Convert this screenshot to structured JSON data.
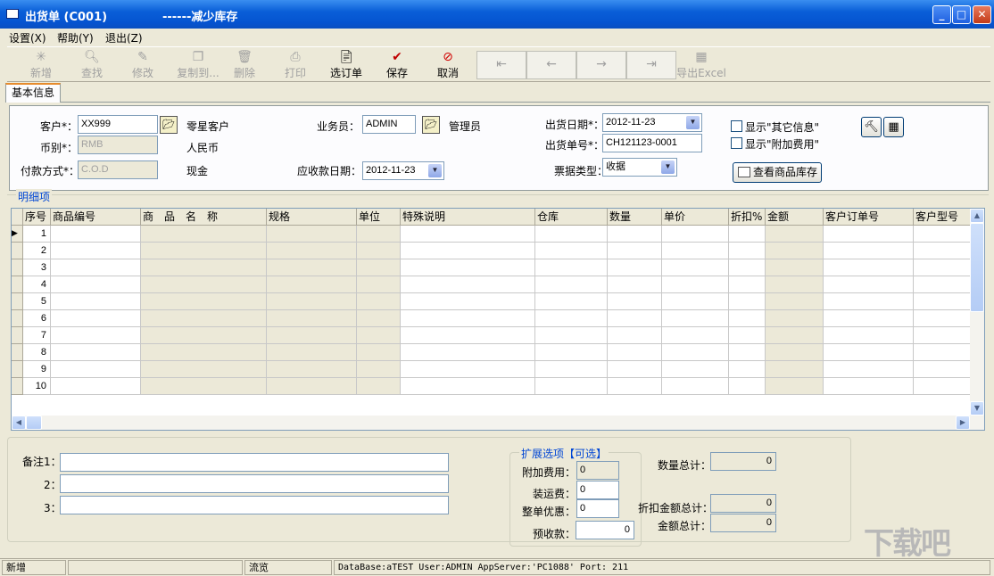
{
  "window": {
    "title": "出货单 (C001)",
    "subtitle": "------减少库存",
    "min_icon": "minimize-icon",
    "max_icon": "maximize-icon",
    "close_icon": "close-icon"
  },
  "menu": [
    "设置(X)",
    "帮助(Y)",
    "退出(Z)"
  ],
  "toolbar": [
    {
      "label": "新增",
      "icon": "new-icon",
      "enabled": false
    },
    {
      "label": "查找",
      "icon": "search-icon",
      "enabled": false
    },
    {
      "label": "修改",
      "icon": "edit-icon",
      "enabled": false
    },
    {
      "label": "复制到...",
      "icon": "copy-icon",
      "enabled": false
    },
    {
      "label": "删除",
      "icon": "delete-icon",
      "enabled": false
    },
    {
      "label": "打印",
      "icon": "print-icon",
      "enabled": false
    },
    {
      "label": "选订单",
      "icon": "select-order-icon",
      "enabled": true
    },
    {
      "label": "保存",
      "icon": "check-icon",
      "enabled": true
    },
    {
      "label": "取消",
      "icon": "cancel-icon",
      "enabled": true
    },
    {
      "label": "",
      "icon": "first-record-icon",
      "enabled": false
    },
    {
      "label": "",
      "icon": "prev-record-icon",
      "enabled": false
    },
    {
      "label": "",
      "icon": "next-record-icon",
      "enabled": false
    },
    {
      "label": "",
      "icon": "last-record-icon",
      "enabled": false
    },
    {
      "label": "导出Excel",
      "icon": "excel-icon",
      "enabled": false
    }
  ],
  "tab": "基本信息",
  "form": {
    "customer_label": "客户*：",
    "customer_value": "XX999",
    "customer_name": "零星客户",
    "currency_label": "币别*：",
    "currency_value": "RMB",
    "currency_name": "人民币",
    "payment_label": "付款方式*：",
    "payment_value": "C.O.D",
    "payment_name": "现金",
    "salesman_label": "业务员：",
    "salesman_value": "ADMIN",
    "salesman_name": "管理员",
    "receivable_date_label": "应收款日期：",
    "receivable_date_value": "2012-11-23",
    "ship_date_label": "出货日期*：",
    "ship_date_value": "2012-11-23",
    "ship_no_label": "出货单号*：",
    "ship_no_value": "CH121123-0001",
    "invoice_type_label": "票据类型：",
    "invoice_type_value": "收据",
    "show_other_label": "显示\"其它信息\"",
    "show_other_checked": false,
    "show_extra_label": "显示\"附加费用\"",
    "show_extra_checked": false,
    "stock_button": "查看商品库存"
  },
  "grid": {
    "group_label": "明细项",
    "columns": [
      "序号",
      "商品编号",
      "商　品　名　称",
      "规格",
      "单位",
      "特殊说明",
      "仓库",
      "数量",
      "单价",
      "折扣%",
      "金额",
      "客户订单号",
      "客户型号"
    ],
    "rows": [
      "1",
      "2",
      "3",
      "4",
      "5",
      "6",
      "7",
      "8",
      "9",
      "10"
    ]
  },
  "bottom": {
    "remark1_label": "备注1：",
    "remark2_label": "2：",
    "remark3_label": "3：",
    "ext_label": "扩展选项【可选】",
    "extra_fee_label": "附加费用：",
    "extra_fee_value": "0",
    "freight_label": "装运费：",
    "freight_value": "0",
    "discount_label": "整单优惠：",
    "discount_value": "0",
    "prepaid_label": "预收款：",
    "prepaid_value": "0",
    "qty_total_label": "数量总计：",
    "qty_total_value": "0",
    "discount_total_label": "折扣金额总计：",
    "discount_total_value": "0",
    "amount_total_label": "金额总计：",
    "amount_total_value": "0"
  },
  "status": {
    "mode": "新增",
    "browse": "流览",
    "info": "DataBase:aTEST User:ADMIN  AppServer:'PC1088'   Port: 211"
  },
  "watermark": "下载吧"
}
